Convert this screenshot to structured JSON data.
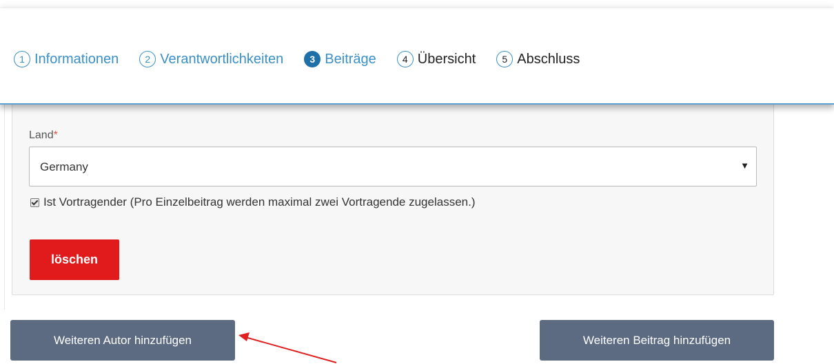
{
  "stepper": {
    "steps": [
      {
        "number": "1",
        "label": "Informationen",
        "state": "done"
      },
      {
        "number": "2",
        "label": "Verantwortlichkeiten",
        "state": "done"
      },
      {
        "number": "3",
        "label": "Beiträge",
        "state": "active"
      },
      {
        "number": "4",
        "label": "Übersicht",
        "state": "future"
      },
      {
        "number": "5",
        "label": "Abschluss",
        "state": "future"
      }
    ]
  },
  "form": {
    "country_label": "Land",
    "required_mark": "*",
    "country_value": "Germany",
    "is_presenter_checked": true,
    "is_presenter_label": "Ist Vortragender (Pro Einzelbeitrag werden maximal zwei Vortragende zugelassen.)",
    "delete_label": "löschen"
  },
  "actions": {
    "add_author_label": "Weiteren Autor hinzufügen",
    "add_contribution_label": "Weiteren Beitrag hinzufügen"
  },
  "colors": {
    "accent": "#3a8fc7",
    "active_step": "#1f6fa8",
    "delete": "#e11b1b",
    "secondary_button": "#5c6a82",
    "annotation_arrow": "#e02020"
  }
}
